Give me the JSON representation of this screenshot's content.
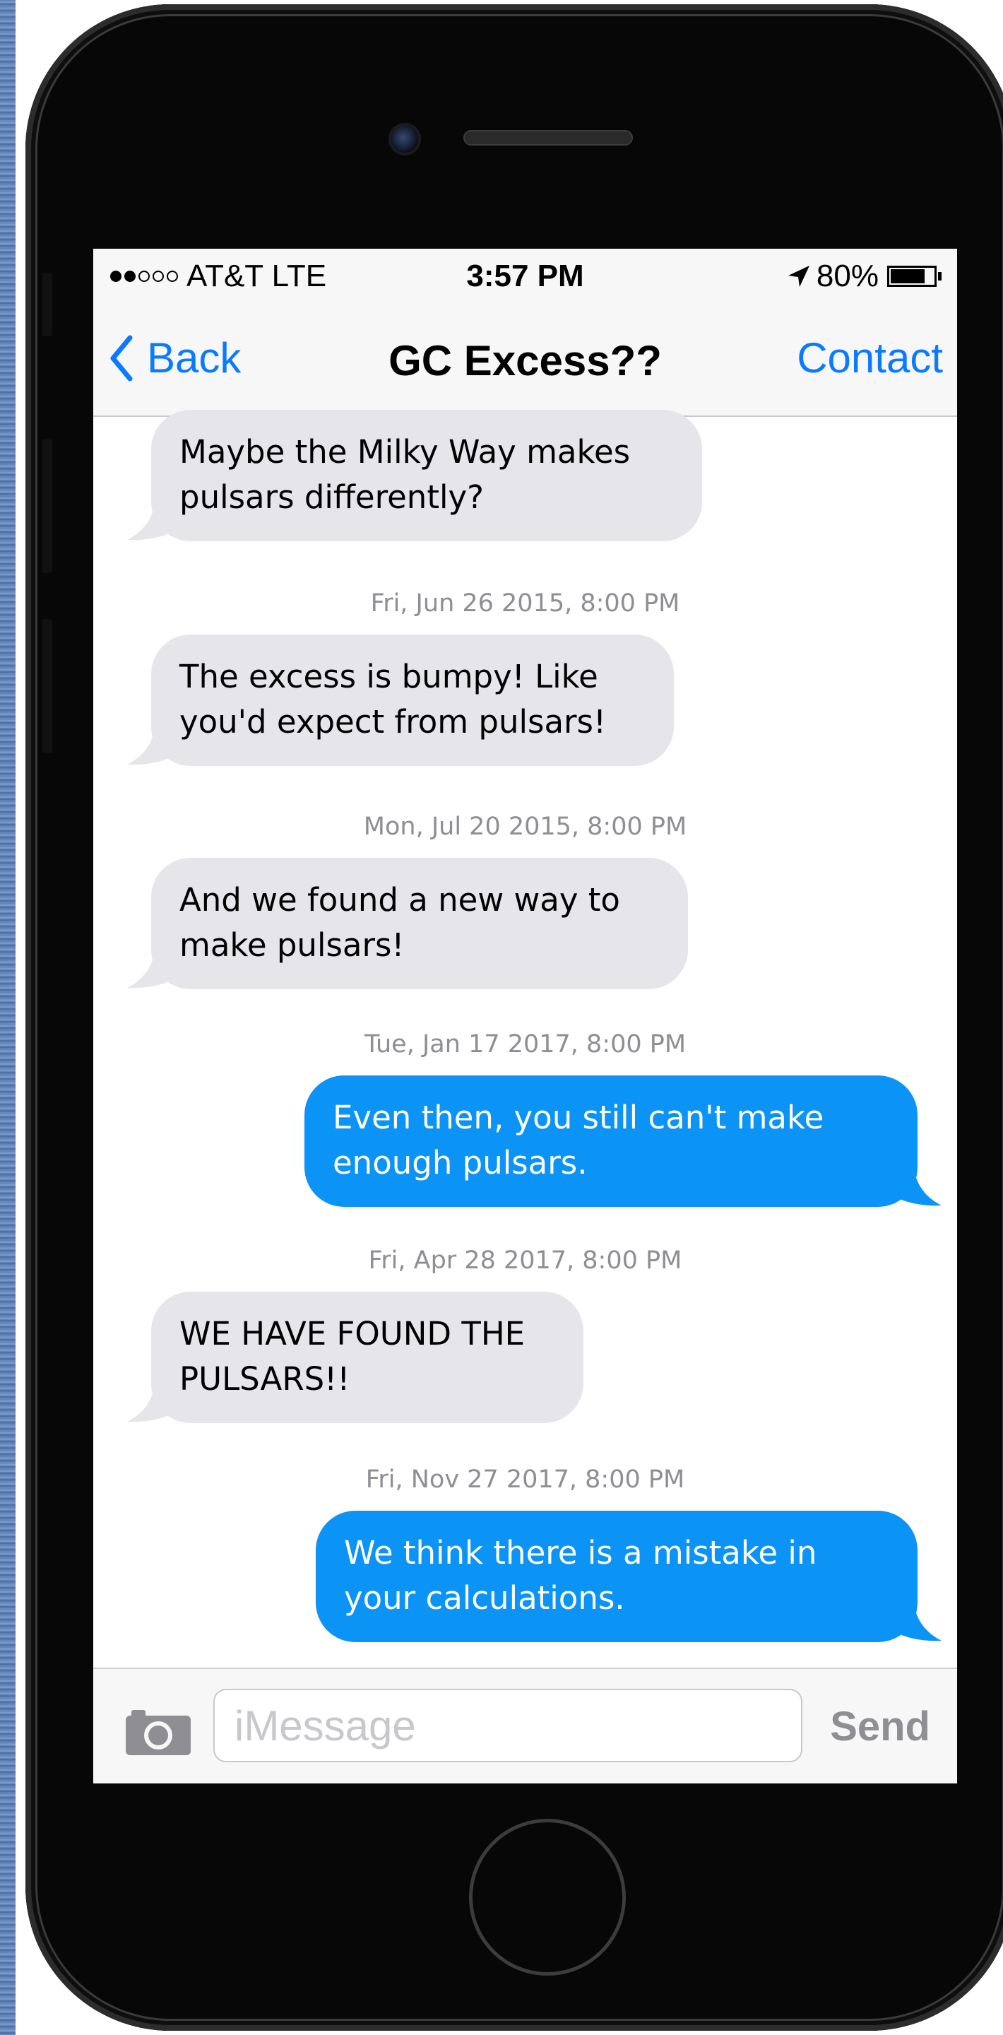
{
  "status_bar": {
    "carrier": "AT&T LTE",
    "time": "3:57 PM",
    "battery_percent": "80%",
    "signal_bars_filled": 2,
    "signal_bars_total": 5,
    "battery_level": 0.8,
    "icons": [
      "signal-dots-icon",
      "location-arrow-icon",
      "battery-icon"
    ]
  },
  "nav": {
    "back_label": "Back",
    "title": "GC Excess??",
    "contact_label": "Contact"
  },
  "thread": {
    "items": [
      {
        "kind": "received",
        "lines": [
          "Maybe the Milky Way makes",
          "pulsars differently?"
        ]
      },
      {
        "kind": "timestamp",
        "text": "Fri, Jun 26 2015, 8:00 PM"
      },
      {
        "kind": "received",
        "lines": [
          "The excess is bumpy! Like",
          "you'd expect from pulsars!"
        ]
      },
      {
        "kind": "timestamp",
        "text": "Mon, Jul 20 2015, 8:00 PM"
      },
      {
        "kind": "received",
        "lines": [
          "And we found a new way to",
          "make pulsars!"
        ]
      },
      {
        "kind": "timestamp",
        "text": "Tue, Jan 17 2017, 8:00 PM"
      },
      {
        "kind": "sent",
        "lines": [
          "Even then, you still can't make",
          "enough pulsars."
        ]
      },
      {
        "kind": "timestamp",
        "text": "Fri, Apr 28 2017, 8:00 PM"
      },
      {
        "kind": "received",
        "lines": [
          "WE HAVE FOUND THE",
          "PULSARS!!"
        ]
      },
      {
        "kind": "timestamp",
        "text": "Fri, Nov 27 2017, 8:00 PM"
      },
      {
        "kind": "sent",
        "lines": [
          "We think there is a mistake in",
          "your calculations."
        ]
      }
    ]
  },
  "composer": {
    "placeholder": "iMessage",
    "value": "",
    "send_label": "Send",
    "camera_icon": "camera-icon"
  },
  "colors": {
    "ios_blue": "#0a7aff",
    "sent_bubble": "#0b93f6",
    "received_bubble": "#e5e5ea",
    "timestamp_gray": "#8e8e93",
    "phone_body": "#070707"
  }
}
